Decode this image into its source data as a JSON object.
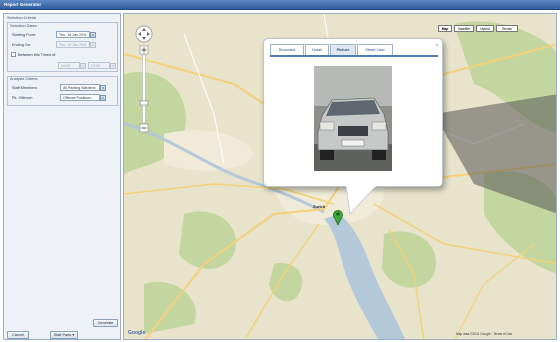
{
  "window": {
    "title": "Report Generator"
  },
  "panel": {
    "selection_header": "Selection Criteria",
    "selection_dates_header": "Selection Dates",
    "starting_from_label": "Starting From:",
    "starting_from_value": "Thu, 15 Jan 2011",
    "ending_on_label": "Ending On:",
    "ending_on_value": "Thu, 15 Jan 2011",
    "between_label": "Between this Times of:",
    "time_from": "00:00",
    "time_to": "23:59",
    "analysis_header": "Analysis Criteria",
    "staff_members_label": "Staff Members:",
    "staff_members_value": "All Parking Wardens",
    "pk_offence_label": "Pk. Offence:",
    "pk_offence_value": "Offence Positions",
    "generate_button": "Generate",
    "cancel_button": "Cancel",
    "staff_parts_button": "Staff Parts"
  },
  "map": {
    "types": [
      "Map",
      "Satellite",
      "Hybrid",
      "Terrain"
    ],
    "active_type": "Map",
    "city_label": "Zurich",
    "google_label": "Google",
    "copyright": "Map data ©2011 Google - Terms of Use",
    "colors": {
      "water": "#b3c8d9",
      "land": "#e8e4cc",
      "park": "#c3d6a0",
      "road": "#f4d178"
    }
  },
  "popup": {
    "tabs": [
      "Recorded",
      "Detail",
      "Picture",
      "Street View"
    ],
    "active_tab": "Picture",
    "close_glyph": "x",
    "photo_icon": "car-photo"
  }
}
